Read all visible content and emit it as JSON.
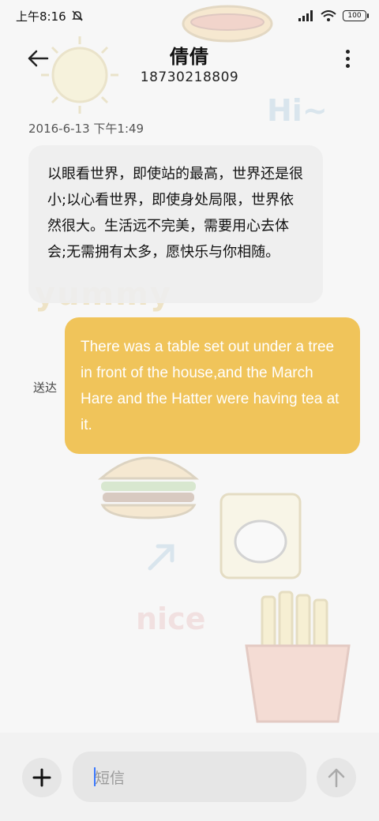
{
  "status_bar": {
    "time": "上午8:16",
    "battery": "100",
    "icons": [
      "mute-bell-icon",
      "signal-icon",
      "wifi-icon",
      "battery-icon"
    ]
  },
  "header": {
    "contact_name": "倩倩",
    "phone_number": "18730218809",
    "icons": [
      "back-arrow-icon",
      "more-vertical-icon"
    ]
  },
  "conversation": {
    "timestamp": "2016-6-13 下午1:49",
    "incoming_message": "以眼看世界，即使站的最高，世界还是很小;以心看世界，即使身处局限，世界依然很大。生活远不完美，需要用心去体会;无需拥有太多，愿快乐与你相随。",
    "outgoing_message": "There was a table set out under a tree in front of the house,and the March Hare and the Hatter were having tea at it.",
    "delivery_status": "送达"
  },
  "wallpaper": {
    "words": [
      "Hi~",
      "yummy",
      "nice"
    ]
  },
  "composer": {
    "placeholder": "短信",
    "icons": [
      "plus-icon",
      "send-arrow-icon"
    ]
  },
  "colors": {
    "outgoing_bubble": "#f0c45a",
    "incoming_bubble": "#eeeeee",
    "caret": "#3a78ff"
  }
}
